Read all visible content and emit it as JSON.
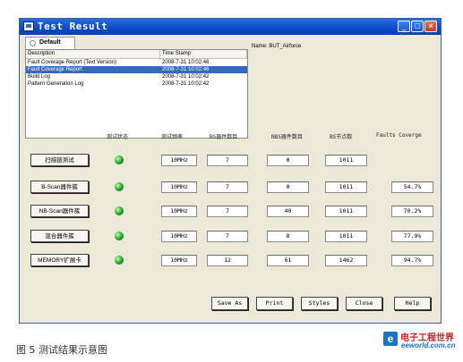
{
  "window": {
    "title": "Test Result",
    "controls": {
      "minimize": "_",
      "maximize": "□",
      "close": "×"
    }
  },
  "tab": {
    "label": "Default"
  },
  "log": {
    "columns": [
      "Description",
      "Time Stamp"
    ],
    "rows": [
      {
        "desc": "Fault Coverage Report (Text Version)",
        "time": "2008-7-31 10:02:46"
      },
      {
        "desc": "Fault Coverage Report",
        "time": "2008-7-31 10:02:46",
        "selected": true
      },
      {
        "desc": "Build Log",
        "time": "2008-7-31 10:02:42"
      },
      {
        "desc": "Pattern Generation Log",
        "time": "2008-7-31 10:02:42"
      }
    ]
  },
  "name_label": "Name: BUT_Airforce",
  "table": {
    "headers": [
      "测试状态",
      "测试频率",
      "BS器件数目",
      "NBS器件数目",
      "BS节点数",
      "Faults Coverge"
    ],
    "rows": [
      {
        "button": "扫描链测试",
        "freq": "10MHz",
        "bs": "7",
        "nbs": "0",
        "nodes": "1011",
        "coverage": ""
      },
      {
        "button": "B-Scan器件簇",
        "freq": "10MHz",
        "bs": "7",
        "nbs": "0",
        "nodes": "1011",
        "coverage": "54.7%"
      },
      {
        "button": "NB-Scan器件簇",
        "freq": "10MHz",
        "bs": "7",
        "nbs": "40",
        "nodes": "1011",
        "coverage": "70.2%"
      },
      {
        "button": "混合器件簇",
        "freq": "10MHz",
        "bs": "7",
        "nbs": "8",
        "nodes": "1011",
        "coverage": "77.9%"
      },
      {
        "button": "MEMORY扩展卡",
        "freq": "10MHz",
        "bs": "12",
        "nbs": "61",
        "nodes": "1462",
        "coverage": "94.7%"
      }
    ]
  },
  "buttons": [
    "Save As",
    "Print",
    "Styles",
    "Close",
    "Help"
  ],
  "caption": "图 5 测试结果示意图",
  "watermark": {
    "cn": "电子工程世界",
    "en": "eeworld.com.cn"
  },
  "colors": {
    "title_bar": "#0a4bc8",
    "selection": "#316ac5",
    "led": "#1f9e22"
  }
}
